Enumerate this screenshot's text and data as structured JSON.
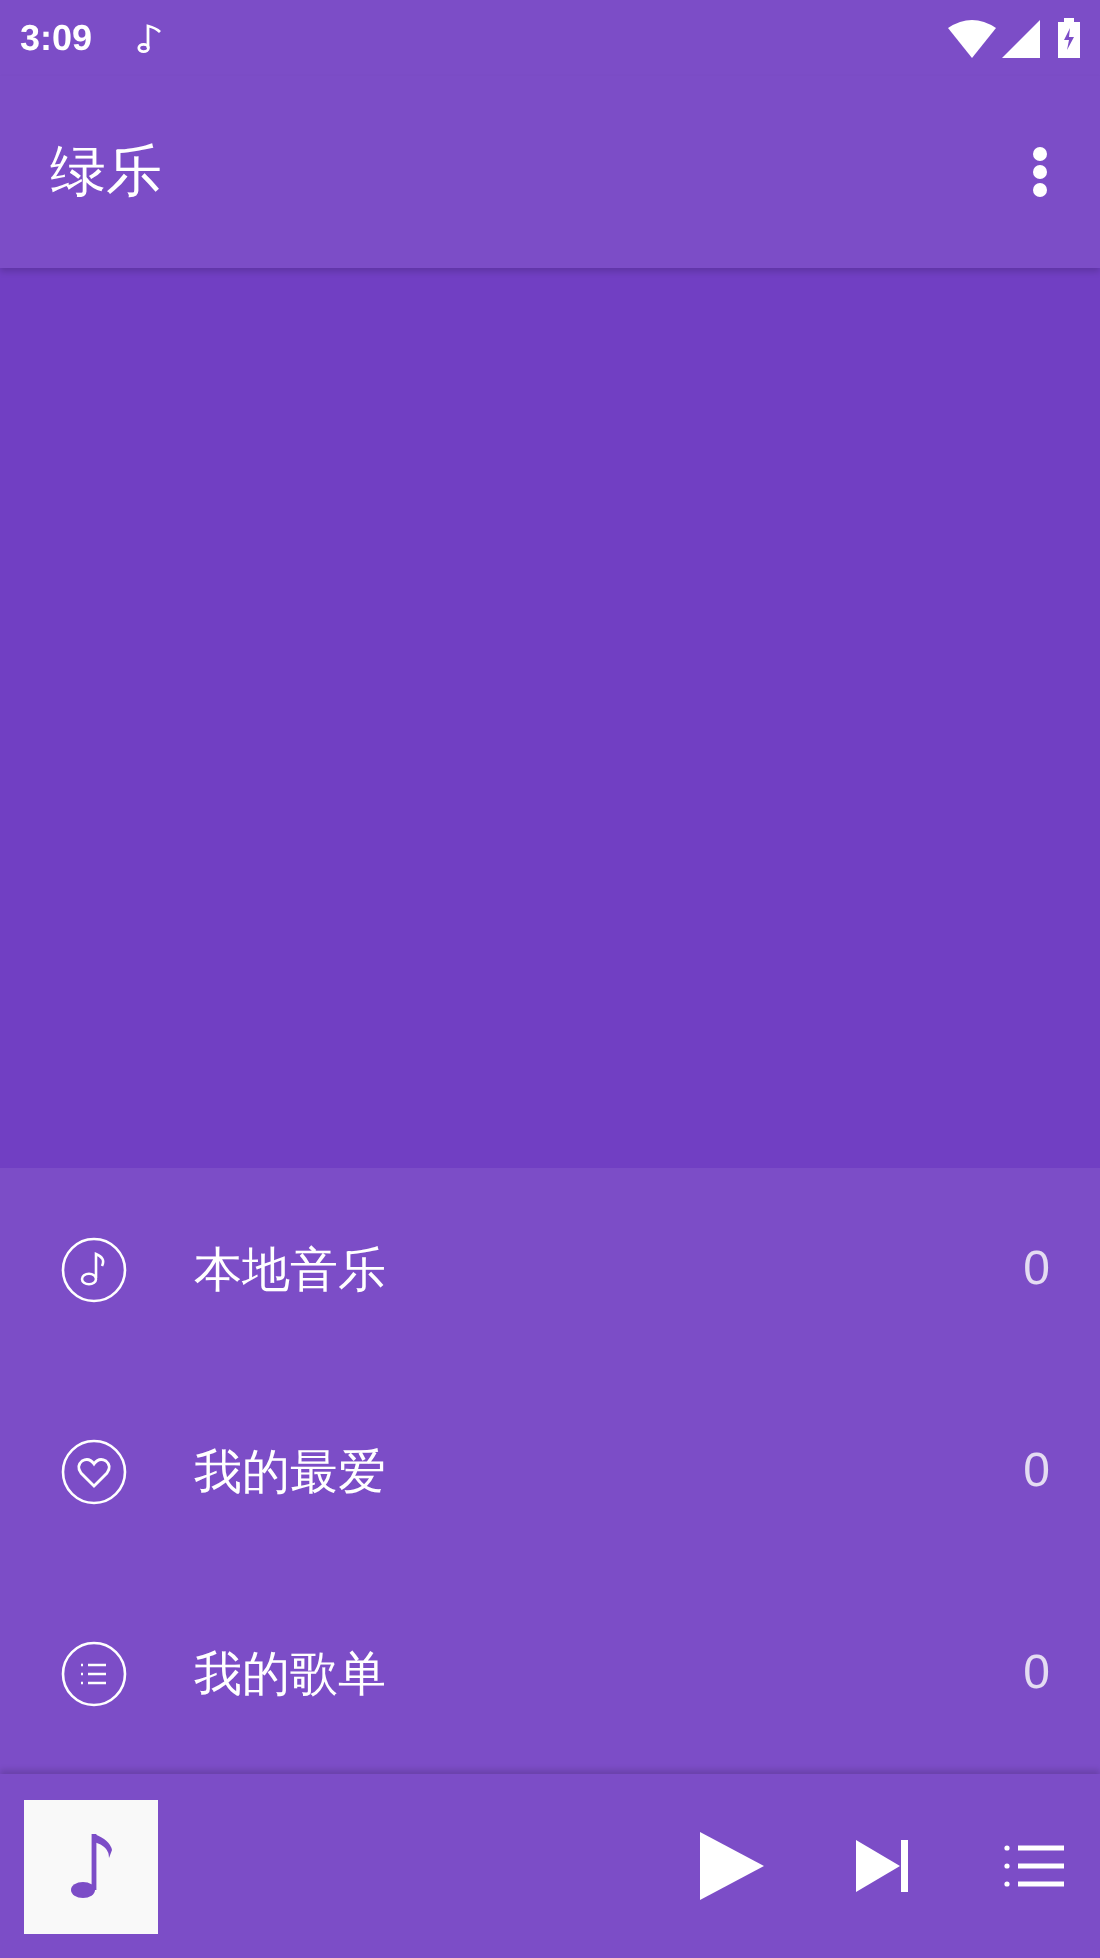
{
  "status_bar": {
    "time": "3:09"
  },
  "app_bar": {
    "title": "绿乐"
  },
  "library": [
    {
      "kind": "local",
      "label": "本地音乐",
      "count": "0"
    },
    {
      "kind": "favorite",
      "label": "我的最爱",
      "count": "0"
    },
    {
      "kind": "playlist",
      "label": "我的歌单",
      "count": "0"
    }
  ]
}
